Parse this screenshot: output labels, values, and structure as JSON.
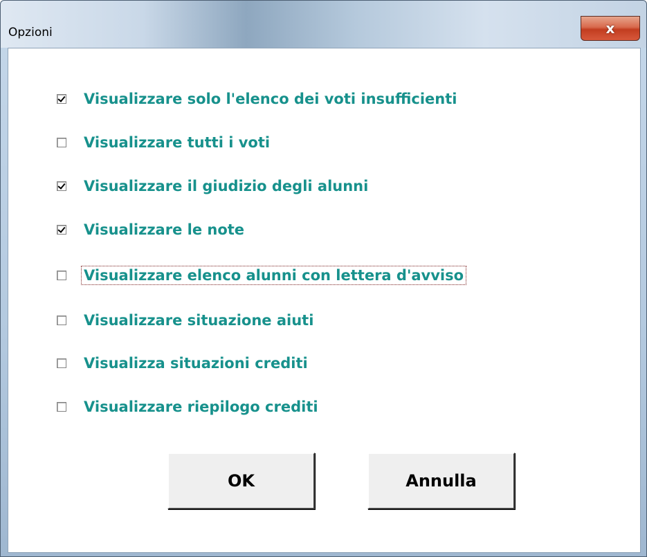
{
  "window": {
    "title": "Opzioni",
    "close_glyph": "x"
  },
  "options": [
    {
      "label": "Visualizzare solo l'elenco dei voti insufficienti",
      "checked": true
    },
    {
      "label": "Visualizzare tutti i voti",
      "checked": false
    },
    {
      "label": "Visualizzare il giudizio degli alunni",
      "checked": true
    },
    {
      "label": "Visualizzare le note",
      "checked": true
    },
    {
      "label": "Visualizzare elenco alunni con lettera d'avviso",
      "checked": false,
      "focused": true
    },
    {
      "label": "Visualizzare situazione aiuti",
      "checked": false
    },
    {
      "label": "Visualizza situazioni crediti",
      "checked": false
    },
    {
      "label": "Visualizzare riepilogo crediti",
      "checked": false
    }
  ],
  "buttons": {
    "ok_label": "OK",
    "cancel_label": "Annulla"
  },
  "colors": {
    "label_text": "#17918c",
    "close_button": "#c23d20"
  }
}
